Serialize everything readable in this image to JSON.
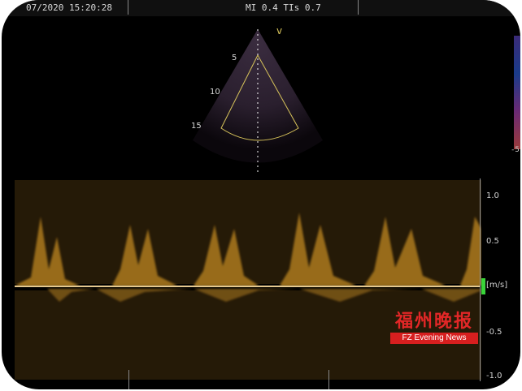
{
  "header": {
    "timestamp": "07/2020 15:20:28",
    "mi_ti": "MI 0.4  TIs 0.7"
  },
  "sector": {
    "depth_labels": [
      "5",
      "10",
      "15"
    ],
    "marker": "v"
  },
  "scale": {
    "labels": [
      "1.0",
      "0.5",
      "-0.5",
      "-1.0"
    ],
    "unit": "[m/s]",
    "right_value": "-5"
  },
  "watermark": {
    "chinese": "福州晚报",
    "banner": "FZ Evening News"
  },
  "colors": {
    "signal": "#c58c24",
    "baseline": "#e6c98f",
    "marker": "#39d43a",
    "watermark": "#e22727"
  }
}
